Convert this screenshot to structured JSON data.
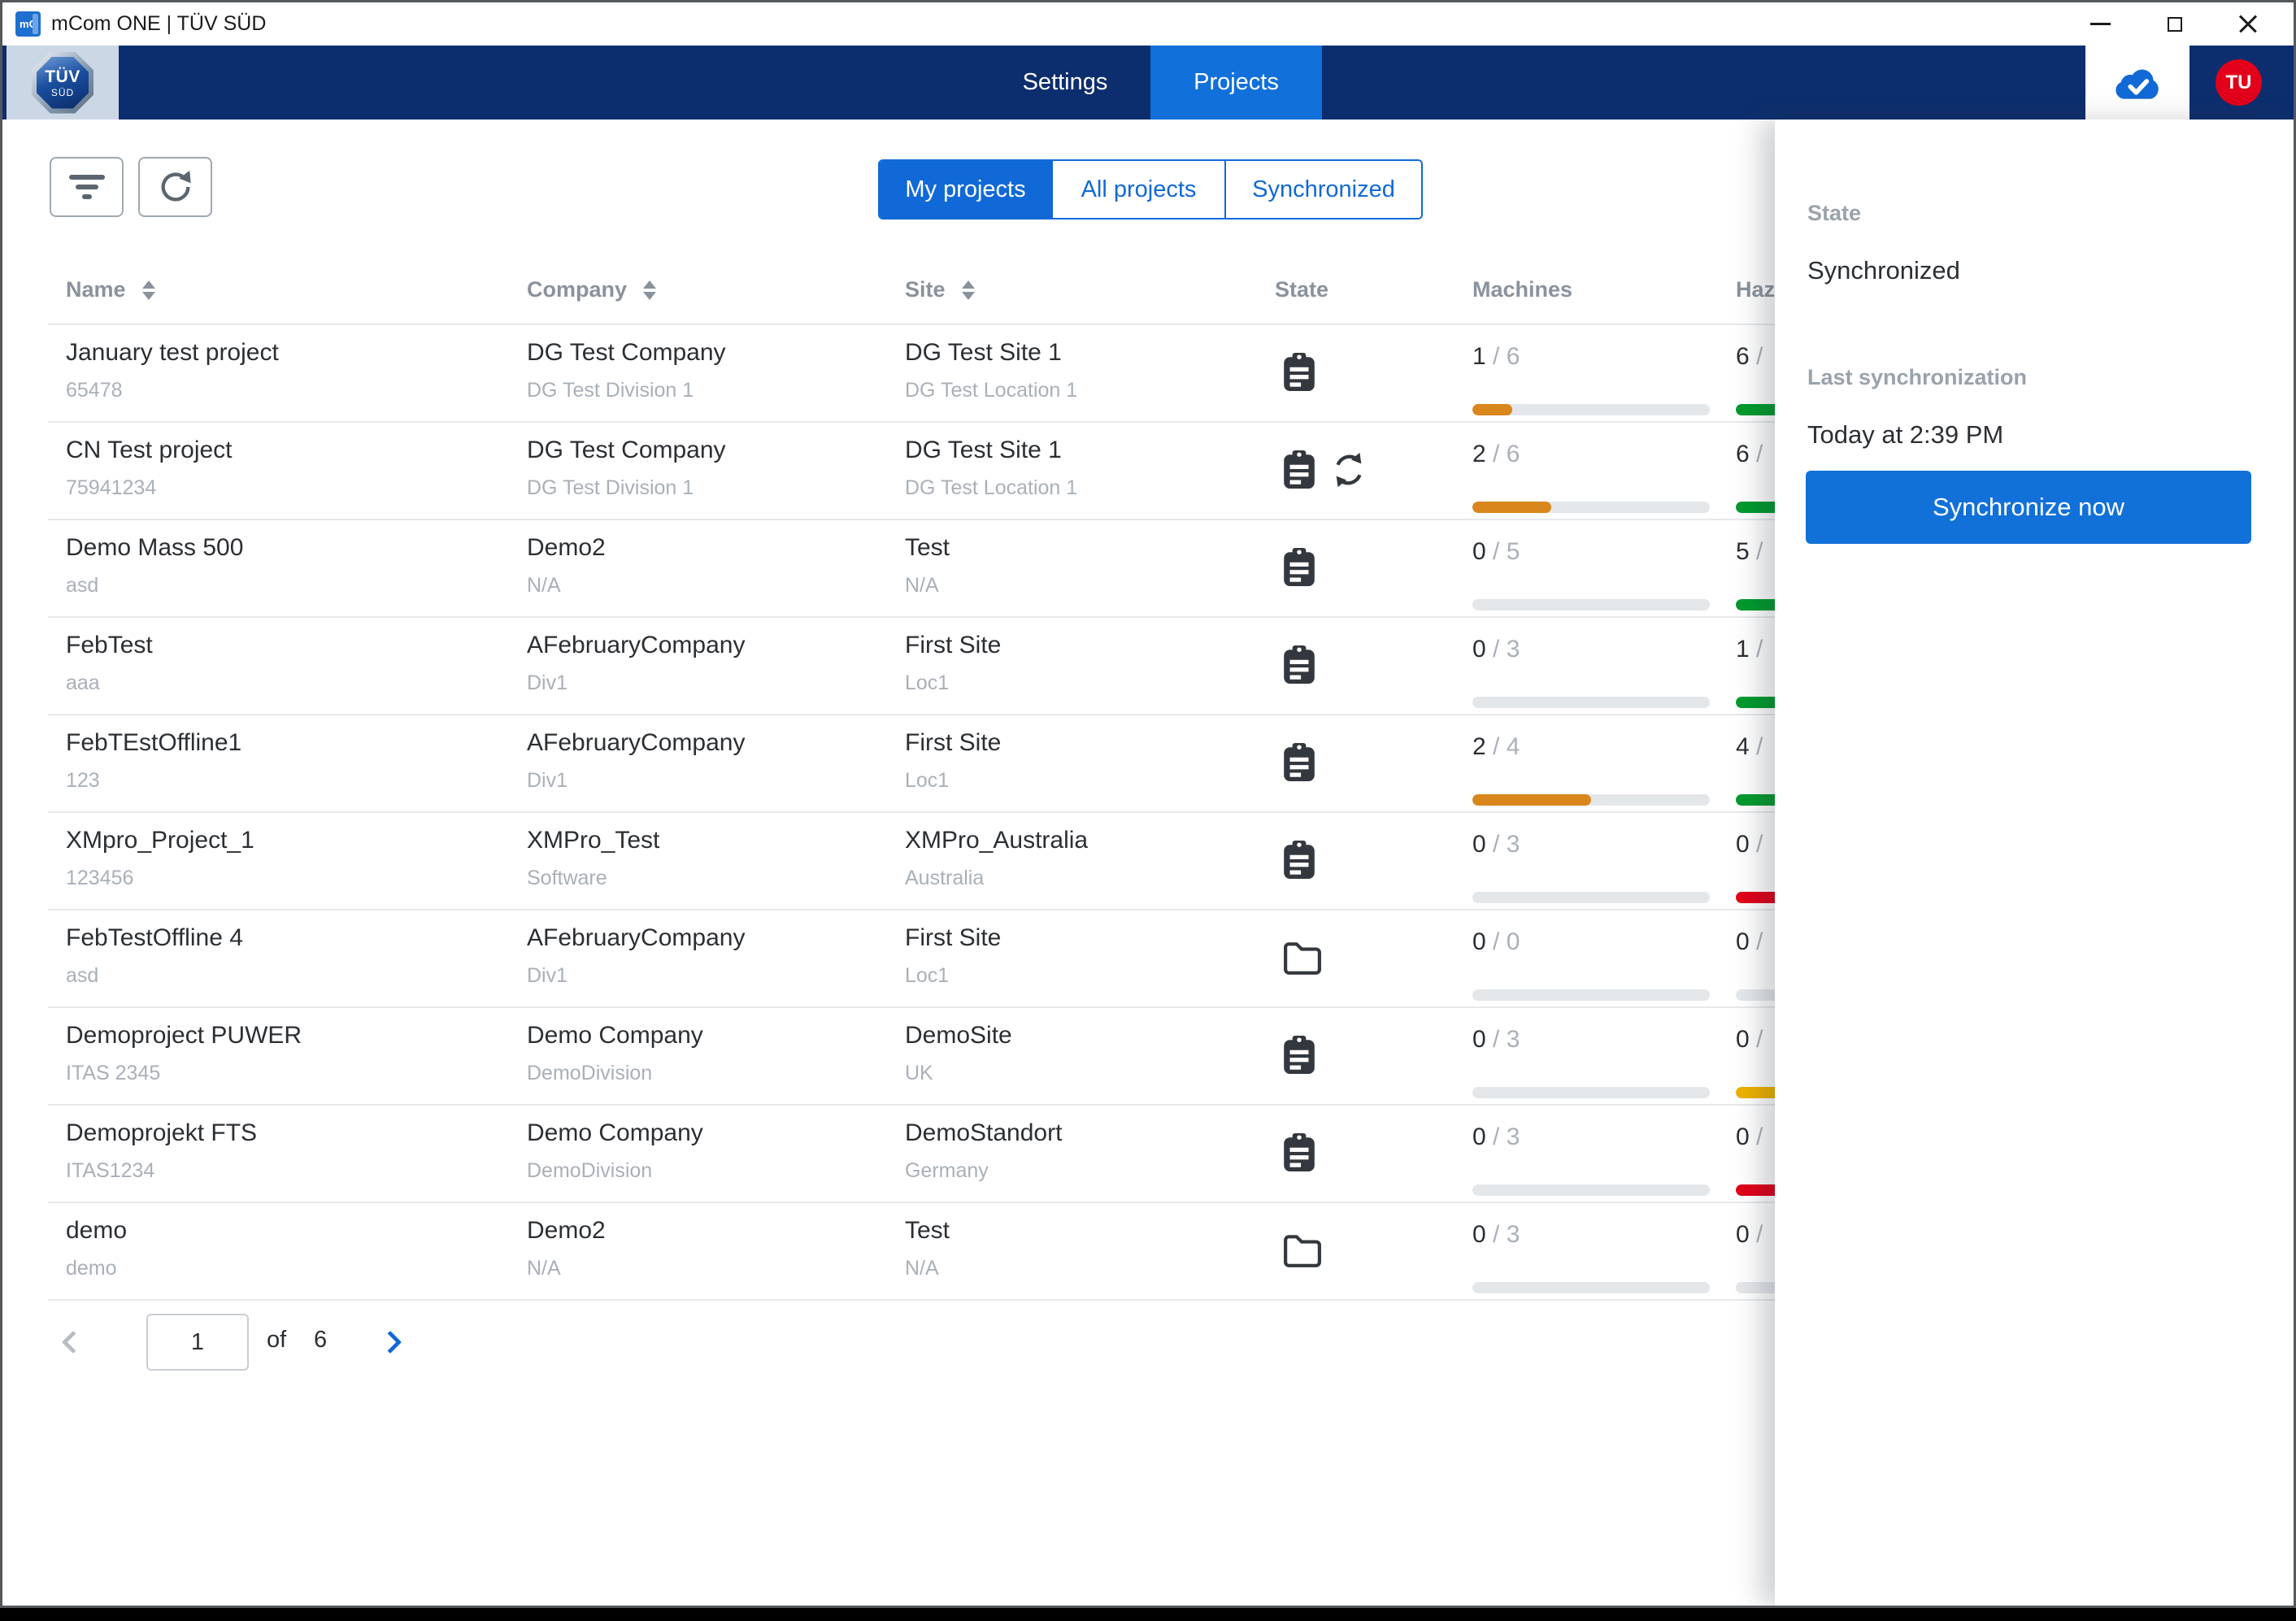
{
  "window": {
    "title": "mCom ONE | TÜV SÜD"
  },
  "logo": {
    "line1": "TÜV",
    "line2": "SÜD"
  },
  "nav": {
    "tabs": [
      {
        "label": "Settings",
        "active": false
      },
      {
        "label": "Projects",
        "active": true
      }
    ],
    "avatar": "TU"
  },
  "toolbar": {
    "view_tabs": [
      {
        "label": "My projects",
        "active": true
      },
      {
        "label": "All projects",
        "active": false
      },
      {
        "label": "Synchronized",
        "active": false
      }
    ]
  },
  "table": {
    "columns": [
      {
        "label": "Name",
        "sortable": true
      },
      {
        "label": "Company",
        "sortable": true
      },
      {
        "label": "Site",
        "sortable": true
      },
      {
        "label": "State",
        "sortable": false
      },
      {
        "label": "Machines",
        "sortable": false
      },
      {
        "label": "Haz",
        "sortable": false
      }
    ],
    "rows": [
      {
        "name": "January test project",
        "code": "65478",
        "company": "DG Test Company",
        "division": "DG Test Division 1",
        "site": "DG Test Site 1",
        "location": "DG Test Location 1",
        "state_icons": [
          "clipboard"
        ],
        "machines": {
          "current": 1,
          "total": 6
        },
        "hazards": {
          "value": "6",
          "suffix": " /",
          "color": "green"
        }
      },
      {
        "name": "CN Test project",
        "code": "75941234",
        "company": "DG Test Company",
        "division": "DG Test Division 1",
        "site": "DG Test Site 1",
        "location": "DG Test Location 1",
        "state_icons": [
          "clipboard",
          "sync"
        ],
        "machines": {
          "current": 2,
          "total": 6
        },
        "hazards": {
          "value": "6",
          "suffix": " /",
          "color": "green"
        }
      },
      {
        "name": "Demo Mass 500",
        "code": "asd",
        "company": "Demo2",
        "division": "N/A",
        "site": "Test",
        "location": "N/A",
        "state_icons": [
          "clipboard"
        ],
        "machines": {
          "current": 0,
          "total": 5
        },
        "hazards": {
          "value": "5",
          "suffix": " /",
          "color": "green"
        }
      },
      {
        "name": "FebTest",
        "code": "aaa",
        "company": "AFebruaryCompany",
        "division": "Div1",
        "site": "First Site",
        "location": "Loc1",
        "state_icons": [
          "clipboard"
        ],
        "machines": {
          "current": 0,
          "total": 3
        },
        "hazards": {
          "value": "1",
          "suffix": " /",
          "color": "green"
        }
      },
      {
        "name": "FebTEstOffline1",
        "code": "123",
        "company": "AFebruaryCompany",
        "division": "Div1",
        "site": "First Site",
        "location": "Loc1",
        "state_icons": [
          "clipboard"
        ],
        "machines": {
          "current": 2,
          "total": 4
        },
        "hazards": {
          "value": "4",
          "suffix": " /",
          "color": "green"
        }
      },
      {
        "name": "XMpro_Project_1",
        "code": "123456",
        "company": "XMPro_Test",
        "division": "Software",
        "site": "XMPro_Australia",
        "location": "Australia",
        "state_icons": [
          "clipboard"
        ],
        "machines": {
          "current": 0,
          "total": 3
        },
        "hazards": {
          "value": "0",
          "suffix": " /",
          "color": "red"
        }
      },
      {
        "name": "FebTestOffline 4",
        "code": "asd",
        "company": "AFebruaryCompany",
        "division": "Div1",
        "site": "First Site",
        "location": "Loc1",
        "state_icons": [
          "folder"
        ],
        "machines": {
          "current": 0,
          "total": 0
        },
        "hazards": {
          "value": "0",
          "suffix": " /",
          "color": "none"
        }
      },
      {
        "name": "Demoproject PUWER",
        "code": "ITAS 2345",
        "company": "Demo Company",
        "division": "DemoDivision",
        "site": "DemoSite",
        "location": "UK",
        "state_icons": [
          "clipboard"
        ],
        "machines": {
          "current": 0,
          "total": 3
        },
        "hazards": {
          "value": "0",
          "suffix": " /",
          "color": "amber"
        }
      },
      {
        "name": "Demoprojekt FTS",
        "code": "ITAS1234",
        "company": "Demo Company",
        "division": "DemoDivision",
        "site": "DemoStandort",
        "location": "Germany",
        "state_icons": [
          "clipboard"
        ],
        "machines": {
          "current": 0,
          "total": 3
        },
        "hazards": {
          "value": "0",
          "suffix": " /",
          "color": "red"
        }
      },
      {
        "name": "demo",
        "code": "demo",
        "company": "Demo2",
        "division": "N/A",
        "site": "Test",
        "location": "N/A",
        "state_icons": [
          "folder"
        ],
        "machines": {
          "current": 0,
          "total": 3
        },
        "hazards": {
          "value": "0",
          "suffix": " /",
          "color": "none"
        }
      }
    ]
  },
  "pagination": {
    "current": "1",
    "of_label": "of",
    "total": "6"
  },
  "panel": {
    "state_label": "State",
    "state_value": "Synchronized",
    "last_sync_label": "Last synchronization",
    "last_sync_value": "Today at 2:39 PM",
    "sync_button": "Synchronize now"
  },
  "colors": {
    "accent": "#1069d6",
    "nav_navy": "#0d2e6e",
    "avatar_red": "#e2001a",
    "machines_orange": "#d9861c",
    "hazard_green": "#009a2e",
    "hazard_red": "#e00019",
    "hazard_amber": "#edb100",
    "bar_track": "#e4e7ea"
  }
}
